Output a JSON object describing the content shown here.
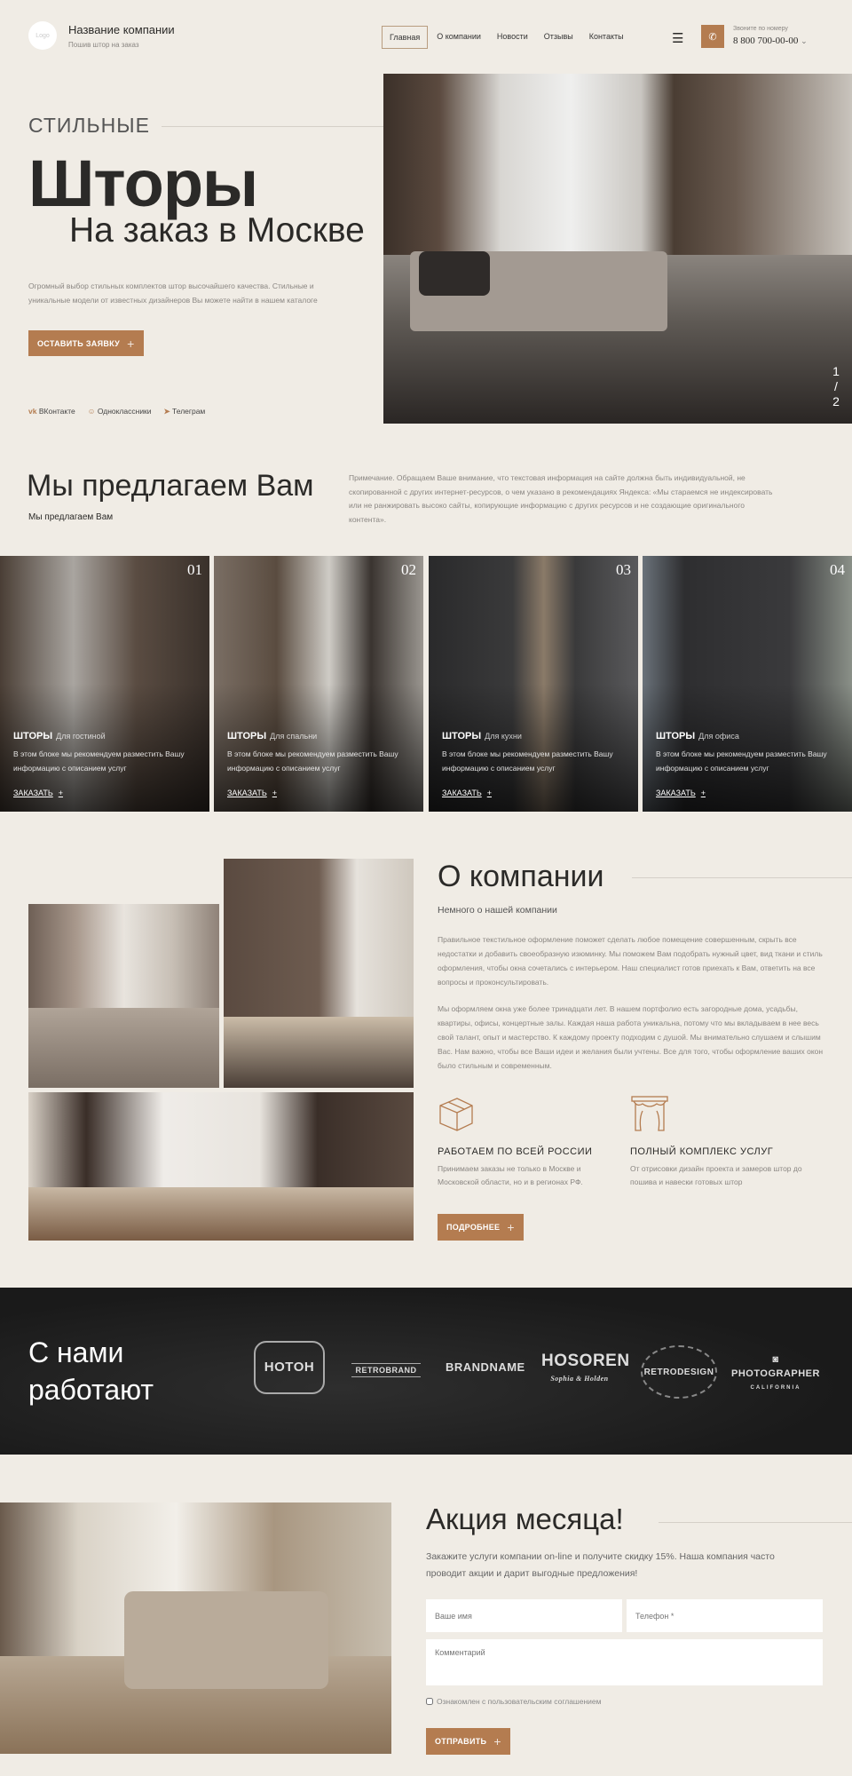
{
  "header": {
    "logo": "Logo",
    "company": "Название компании",
    "tagline": "Пошив штор на заказ",
    "nav": [
      "Главная",
      "О компании",
      "Новости",
      "Отзывы",
      "Контакты"
    ],
    "phone_label": "Звоните по номеру",
    "phone": "8 800 700-00-00"
  },
  "hero": {
    "eyebrow": "СТИЛЬНЫЕ",
    "title": "Шторы",
    "subtitle": "На заказ в Москве",
    "text": "Огромный выбор стильных комплектов штор высочайшего качества. Стильные и уникальные модели от известных дизайнеров Вы можете найти в нашем каталоге",
    "cta": "ОСТАВИТЬ ЗАЯВКУ",
    "slide_current": "1",
    "slide_sep": "/",
    "slide_total": "2",
    "social": [
      "ВКонтакте",
      "Одноклассники",
      "Телеграм"
    ]
  },
  "offer": {
    "title": "Мы предлагаем Вам",
    "subtitle": "Мы предлагаем Вам",
    "note": "Примечание. Обращаем Ваше внимание, что текстовая информация на сайте должна быть индивидуальной, не скопированной с других интернет-ресурсов, о чем указано в рекомендациях Яндекса: «Мы стараемся не индексировать или не ранжировать высоко сайты, копирующие информацию с других ресурсов и не создающие оригинального контента»."
  },
  "cards": [
    {
      "num": "01",
      "title": "ШТОРЫ",
      "sub": "Для гостиной",
      "text": "В этом блоке мы рекомендуем разместить Вашу информацию с описанием  услуг",
      "link": "ЗАКАЗАТЬ"
    },
    {
      "num": "02",
      "title": "ШТОРЫ",
      "sub": "Для спальни",
      "text": "В этом блоке мы рекомендуем разместить Вашу информацию с описанием услуг",
      "link": "ЗАКАЗАТЬ"
    },
    {
      "num": "03",
      "title": "ШТОРЫ",
      "sub": "Для кухни",
      "text": "В этом блоке мы рекомендуем разместить Вашу информацию с описанием услуг",
      "link": "ЗАКАЗАТЬ"
    },
    {
      "num": "04",
      "title": "ШТОРЫ",
      "sub": "Для офиса",
      "text": "В этом блоке мы рекомендуем разместить Вашу информацию с описанием услуг",
      "link": "ЗАКАЗАТЬ"
    }
  ],
  "about": {
    "title": "О компании",
    "subtitle": "Немного о нашей компании",
    "p1": "Правильное текстильное оформление поможет сделать любое помещение совершенным, скрыть все недостатки и добавить своеобразную изюминку. Мы поможем Вам подобрать нужный цвет, вид ткани и стиль оформления, чтобы окна сочетались с интерьером. Наш специалист готов приехать к Вам, ответить на все вопросы и проконсультировать.",
    "p2": "Мы оформляем окна уже более тринадцати лет. В нашем портфолио есть загородные дома, усадьбы, квартиры, офисы, концертные залы. Каждая наша работа уникальна, потому что мы вкладываем в нее весь свой талант, опыт и мастерство. К каждому проекту подходим с душой. Мы внимательно слушаем и слышим Вас. Нам важно, чтобы все Ваши идеи и желания были учтены. Все для того, чтобы оформление ваших окон было стильным и современным.",
    "features": [
      {
        "title": "РАБОТАЕМ ПО ВСЕЙ РОССИИ",
        "text": "Принимаем заказы не только в Москве и Московской области, но и в регионах РФ."
      },
      {
        "title": "ПОЛНЫЙ КОМПЛЕКС УСЛУГ",
        "text": "От отрисовки дизайн проекта и замеров штор до пошива и навески готовых штор"
      }
    ],
    "button": "ПОДРОБНЕЕ"
  },
  "partners": {
    "title1": "С нами",
    "title2": "работают",
    "logos": [
      "HOTOH",
      "RETROBRAND",
      "BRANDNAME",
      "HOSOREN",
      "RETRODESIGN",
      "PHOTOGRAPHER"
    ],
    "hosoren_sub": "Sophia & Holden",
    "photographer_sub": "CALIFORNIA"
  },
  "promo": {
    "title": "Акция месяца!",
    "text": "Закажите услуги компании on-line и получите скидку 15%. Наша компания часто проводит акции и дарит выгодные предложения!",
    "name_placeholder": "Ваше имя",
    "phone_placeholder": "Телефон *",
    "comment_placeholder": "Комментарий",
    "agree": "Ознакомлен с пользовательским соглашением",
    "submit": "ОТПРАВИТЬ"
  },
  "colors": {
    "accent": "#b47c50",
    "bg": "#f0ece5",
    "dark": "#1e1e1e"
  }
}
